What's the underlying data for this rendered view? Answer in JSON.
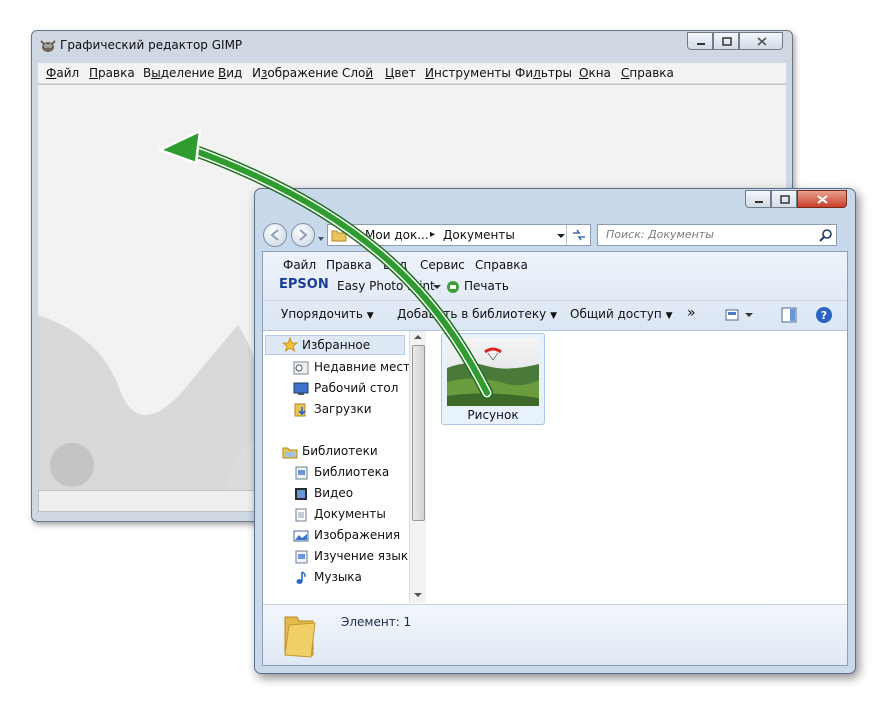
{
  "gimp": {
    "title": "Графический редактор GIMP",
    "menu": [
      {
        "label": "Файл",
        "u": "Ф",
        "rest": "айл"
      },
      {
        "label": "Правка",
        "u": "П",
        "rest": "равка"
      },
      {
        "label": "Выделение",
        "pre": "В",
        "u": "ы",
        "rest": "деление"
      },
      {
        "label": "Вид",
        "u": "В",
        "rest": "ид"
      },
      {
        "label": "Изображение",
        "pre": "И",
        "u": "з",
        "rest": "ображение"
      },
      {
        "label": "Слой",
        "pre": "Сло",
        "u": "й",
        "rest": ""
      },
      {
        "label": "Цвет",
        "u": "Ц",
        "rest": "вет"
      },
      {
        "label": "Инструменты",
        "u": "И",
        "rest": "нструменты"
      },
      {
        "label": "Фильтры",
        "pre": "Фи",
        "u": "л",
        "rest": "ьтры"
      },
      {
        "label": "Окна",
        "u": "О",
        "rest": "кна"
      },
      {
        "label": "Справка",
        "u": "С",
        "rest": "правка"
      }
    ]
  },
  "explorer": {
    "address": {
      "prefix": "«",
      "crumb1": "Мои док...",
      "sep": "▸",
      "crumb2": "Документы"
    },
    "search_placeholder": "Поиск: Документы",
    "menu": [
      "Файл",
      "Правка",
      "Вид",
      "Сервис",
      "Справка"
    ],
    "epson": {
      "brand": "EPSON",
      "label": "Easy Photo Print",
      "print": "Печать"
    },
    "toolbar": {
      "organize": "Упорядочить",
      "add_library": "Добавить в библиотеку",
      "share": "Общий доступ",
      "more": "»"
    },
    "nav": {
      "favorites": "Избранное",
      "favorites_items": [
        "Недавние места",
        "Рабочий стол",
        "Загрузки"
      ],
      "libraries": "Библиотеки",
      "libraries_items": [
        "Библиотека",
        "Видео",
        "Документы",
        "Изображения",
        "Изучение языка",
        "Музыка"
      ]
    },
    "files": [
      {
        "name": "Рисунок",
        "type": "image"
      }
    ],
    "details": {
      "count_text": "Элемент: 1"
    }
  },
  "colors": {
    "arrow": "#2f9c2f",
    "selection": "#cce4f7"
  }
}
